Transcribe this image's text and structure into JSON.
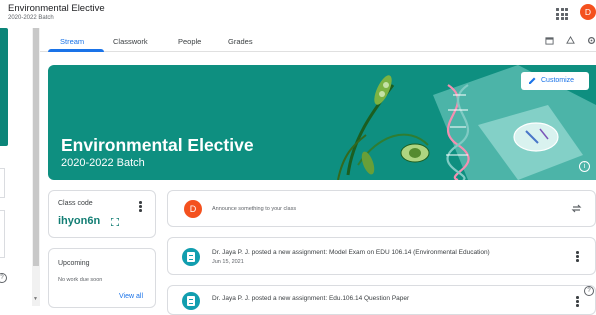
{
  "header": {
    "title": "Environmental Elective",
    "subtitle": "2020-2022 Batch",
    "avatar_letter": "D",
    "apps_icon": "apps-grid-icon"
  },
  "tabs": [
    {
      "label": "Stream",
      "active": true
    },
    {
      "label": "Classwork",
      "active": false
    },
    {
      "label": "People",
      "active": false
    },
    {
      "label": "Grades",
      "active": false
    }
  ],
  "tab_icons": [
    "calendar-icon",
    "drive-folder-icon",
    "settings-icon"
  ],
  "banner": {
    "title": "Environmental Elective",
    "subtitle": "2020-2022 Batch",
    "customize_label": "Customize",
    "bg_color": "#0e8f80"
  },
  "class_code": {
    "title": "Class code",
    "code": "ihyon6n"
  },
  "upcoming": {
    "title": "Upcoming",
    "empty_text": "No work due soon",
    "view_all": "View all"
  },
  "announce": {
    "avatar_letter": "D",
    "placeholder": "Announce something to your class"
  },
  "stream_items": [
    {
      "title": "Dr. Jaya P. J. posted a new assignment: Model Exam on EDU 106.14 (Environmental Education)",
      "date": "Jun 15, 2021"
    },
    {
      "title": "Dr. Jaya P. J. posted a new assignment: Edu.106.14 Question Paper",
      "date": ""
    }
  ],
  "colors": {
    "accent": "#1a73e8",
    "teal": "#137e74",
    "avatar": "#f4511e"
  }
}
